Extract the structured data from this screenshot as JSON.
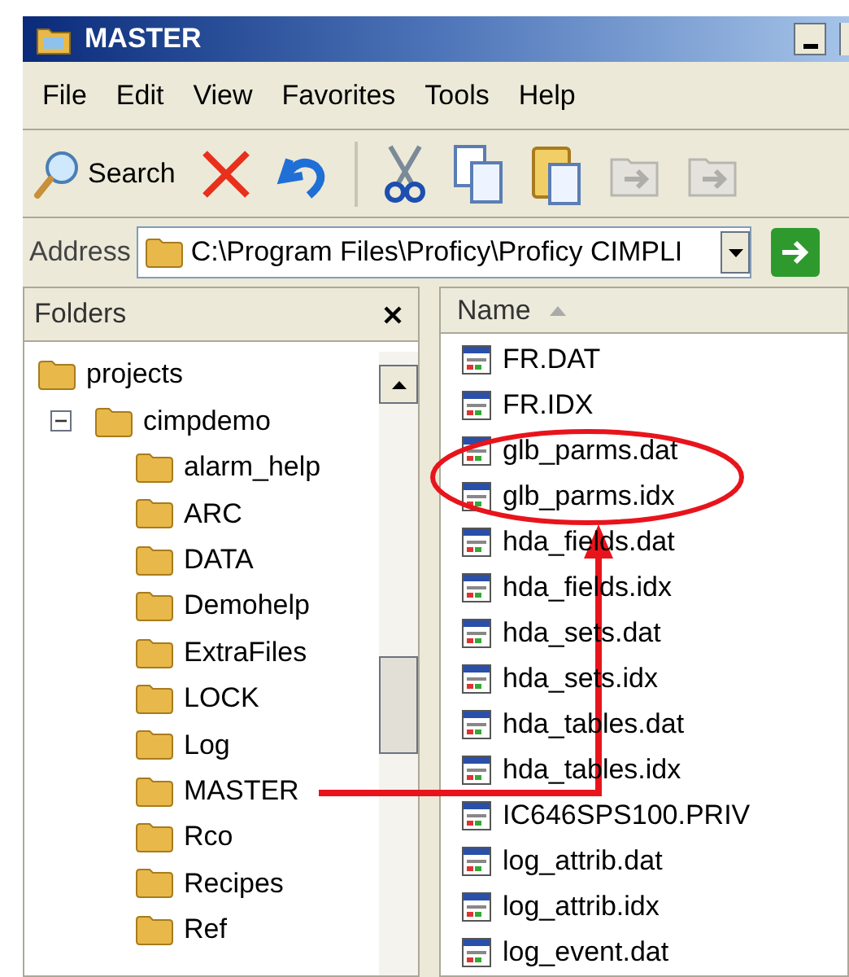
{
  "window": {
    "title": "MASTER"
  },
  "menu": [
    "File",
    "Edit",
    "View",
    "Favorites",
    "Tools",
    "Help"
  ],
  "toolbar": [
    {
      "kind": "search",
      "label": "Search",
      "disabled": false
    },
    {
      "kind": "delete",
      "disabled": false
    },
    {
      "kind": "undo",
      "disabled": false
    },
    {
      "kind": "cut",
      "disabled": false
    },
    {
      "kind": "copy",
      "disabled": false
    },
    {
      "kind": "paste",
      "disabled": false
    },
    {
      "kind": "move",
      "disabled": true
    },
    {
      "kind": "copyto",
      "disabled": true
    }
  ],
  "address": {
    "label": "Address",
    "value": "C:\\Program Files\\Proficy\\Proficy CIMPLI"
  },
  "folders": {
    "title": "Folders",
    "tree": [
      {
        "name": "projects",
        "children": [
          {
            "name": "cimpdemo",
            "expanded": true,
            "children": [
              {
                "name": "alarm_help"
              },
              {
                "name": "ARC"
              },
              {
                "name": "DATA"
              },
              {
                "name": "Demohelp"
              },
              {
                "name": "ExtraFiles"
              },
              {
                "name": "LOCK"
              },
              {
                "name": "Log"
              },
              {
                "name": "MASTER"
              },
              {
                "name": "Rco"
              },
              {
                "name": "Recipes"
              },
              {
                "name": "Ref"
              }
            ]
          }
        ]
      }
    ]
  },
  "files": {
    "column": "Name",
    "items": [
      "FR.DAT",
      "FR.IDX",
      "glb_parms.dat",
      "glb_parms.idx",
      "hda_fields.dat",
      "hda_fields.idx",
      "hda_sets.dat",
      "hda_sets.idx",
      "hda_tables.dat",
      "hda_tables.idx",
      "IC646SPS100.PRIV",
      "log_attrib.dat",
      "log_attrib.idx",
      "log_event.dat"
    ]
  }
}
